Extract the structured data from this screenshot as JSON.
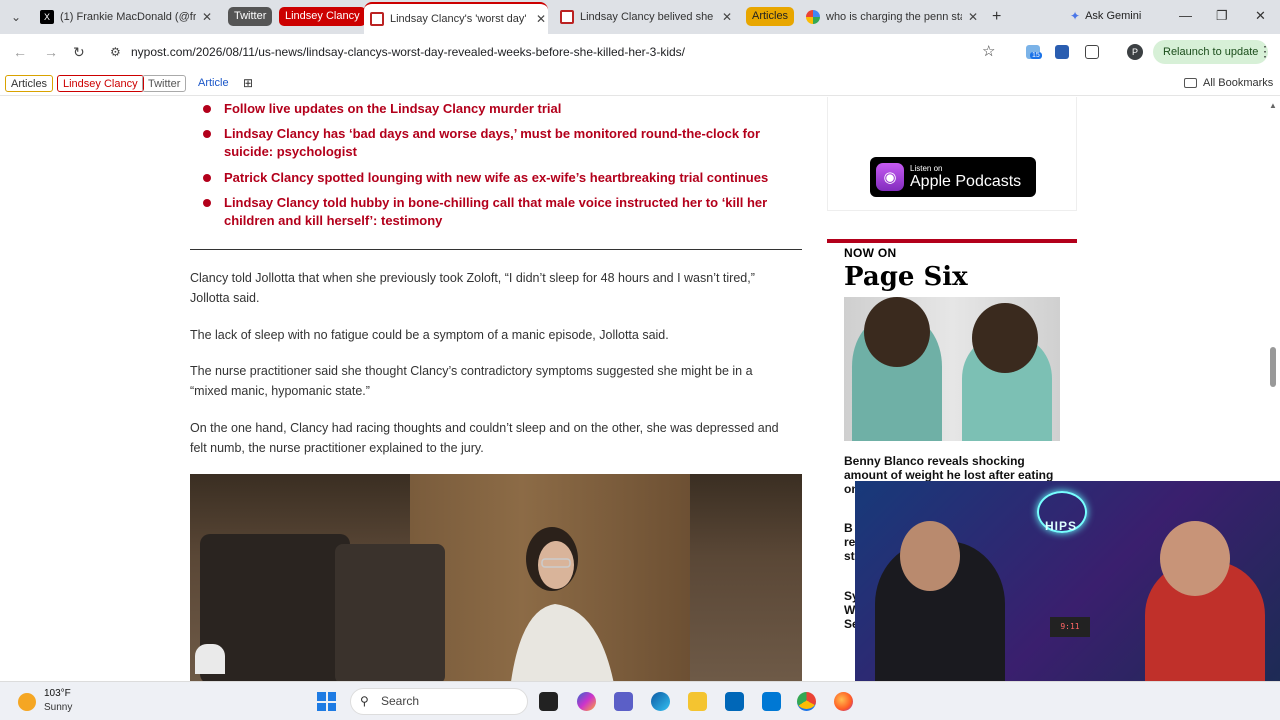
{
  "tabs": [
    {
      "title": "(1) Frankie MacDonald (@fran",
      "icon": "x-logo-icon"
    },
    {
      "title": "Lindsay Clancy's 'worst day' r",
      "icon": "nypost-icon",
      "active": true
    },
    {
      "title": "Lindsay Clancy belived she w",
      "icon": "nypost-icon"
    },
    {
      "title": "who is charging the penn stat",
      "icon": "google-icon"
    }
  ],
  "tab_groups": [
    "Twitter",
    "Lindsey Clancy",
    "Articles"
  ],
  "ask_gemini": "Ask Gemini",
  "url": "nypost.com/2026/08/11/us-news/lindsay-clancys-worst-day-revealed-weeks-before-she-killed-her-3-kids/",
  "extension_badge": "15",
  "profile_initial": "P",
  "relaunch_label": "Relaunch to update",
  "bookmarks": {
    "articles": "Articles",
    "lindsey": "Lindsey Clancy",
    "twitter": "Twitter",
    "article": "Article",
    "all": "All Bookmarks"
  },
  "related_links": [
    "Follow live updates on the Lindsay Clancy murder trial",
    "Lindsay Clancy has ‘bad days and worse days,’ must be monitored round-the-clock for suicide: psychologist",
    "Patrick Clancy spotted lounging with new wife as ex-wife’s heartbreaking trial continues",
    "Lindsay Clancy told hubby in bone-chilling call that male voice instructed her to ‘kill her children and kill herself’: testimony"
  ],
  "paragraphs": [
    "Clancy told Jollotta that when she previously took Zoloft, “I didn’t sleep for 48 hours and I wasn’t tired,” Jollotta said.",
    "The lack of sleep with no fatigue could be a symptom of a manic episode, Jollotta said.",
    "The nurse practitioner said she thought Clancy’s contradictory symptoms suggested she might be in a “mixed manic, hypomanic state.”",
    "On the one hand, Clancy had racing thoughts and couldn’t sleep and on the other, she was depressed and felt numb, the nurse practitioner explained to the jury."
  ],
  "sidebar": {
    "podcast_small": "Listen on",
    "podcast_big": "Apple Podcasts",
    "now_on": "NOW ON",
    "brand": "Page Six",
    "headline": "Benny Blanco reveals shocking amount of weight he lost after eating",
    "headline_tail": "on",
    "frag_b": "B",
    "frag_re": "re",
    "frag_st": "st",
    "frag_sy": "Sy",
    "frag_w": "W",
    "frag_se": "Se"
  },
  "webcam": {
    "sign": "HIPS",
    "clock": "9:11"
  },
  "taskbar": {
    "temperature": "103°F",
    "condition": "Sunny",
    "search": "Search"
  },
  "colors": {
    "nypost_red": "#b3001b",
    "chrome_tabstrip": "#dee1e6"
  }
}
